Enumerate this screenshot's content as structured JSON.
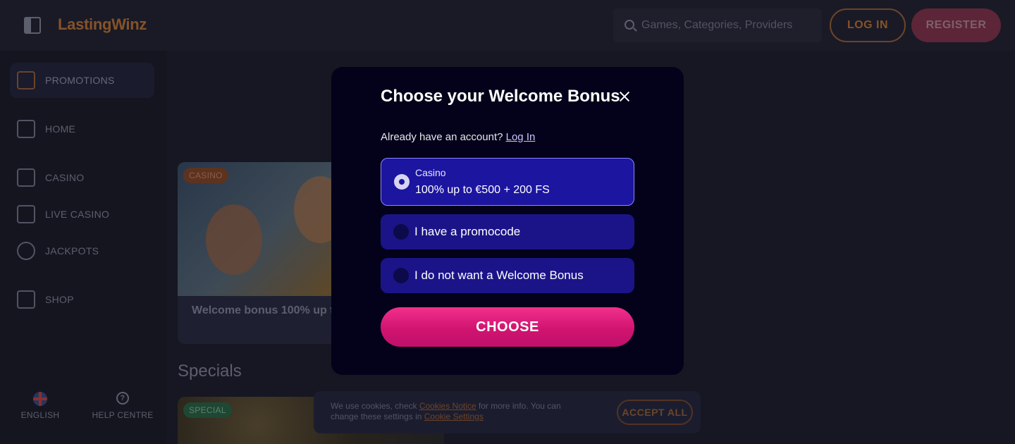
{
  "header": {
    "logo": "LastingWinz",
    "search_placeholder": "Games, Categories, Providers",
    "login_label": "LOG IN",
    "register_label": "REGISTER"
  },
  "sidebar": {
    "items": [
      {
        "label": "PROMOTIONS",
        "icon": "gift-icon"
      },
      {
        "label": "HOME",
        "icon": "home-icon"
      },
      {
        "label": "CASINO",
        "icon": "slot-machine-icon"
      },
      {
        "label": "LIVE CASINO",
        "icon": "card-icon"
      },
      {
        "label": "JACKPOTS",
        "icon": "clover-icon"
      },
      {
        "label": "SHOP",
        "icon": "basket-icon"
      }
    ],
    "language_label": "ENGLISH",
    "help_label": "HELP CENTRE"
  },
  "main": {
    "promo_card": {
      "tag": "CASINO",
      "text": "Welcome bonus 100% up to"
    },
    "specials_title": "Specials",
    "special_card": {
      "tag": "SPECIAL"
    }
  },
  "cookie": {
    "text_before": "We use cookies, check ",
    "notice_link": "Cookies Notice",
    "text_middle": " for more info. You can change these settings in ",
    "settings_link": "Cookie Settings",
    "accept_label": "ACCEPT ALL"
  },
  "modal": {
    "title": "Choose your Welcome Bonus",
    "account_prompt": "Already have an account? ",
    "login_link": "Log In",
    "options": [
      {
        "small": "Casino",
        "main": "100% up to €500 + 200 FS",
        "selected": true
      },
      {
        "main": "I have a promocode",
        "selected": false
      },
      {
        "main": "I do not want a Welcome Bonus",
        "selected": false
      }
    ],
    "choose_label": "CHOOSE"
  },
  "colors": {
    "accent_orange": "#c97a3a",
    "modal_bg": "#03021a",
    "option_bg": "#1b1488",
    "choose_pink": "#e0207c"
  }
}
